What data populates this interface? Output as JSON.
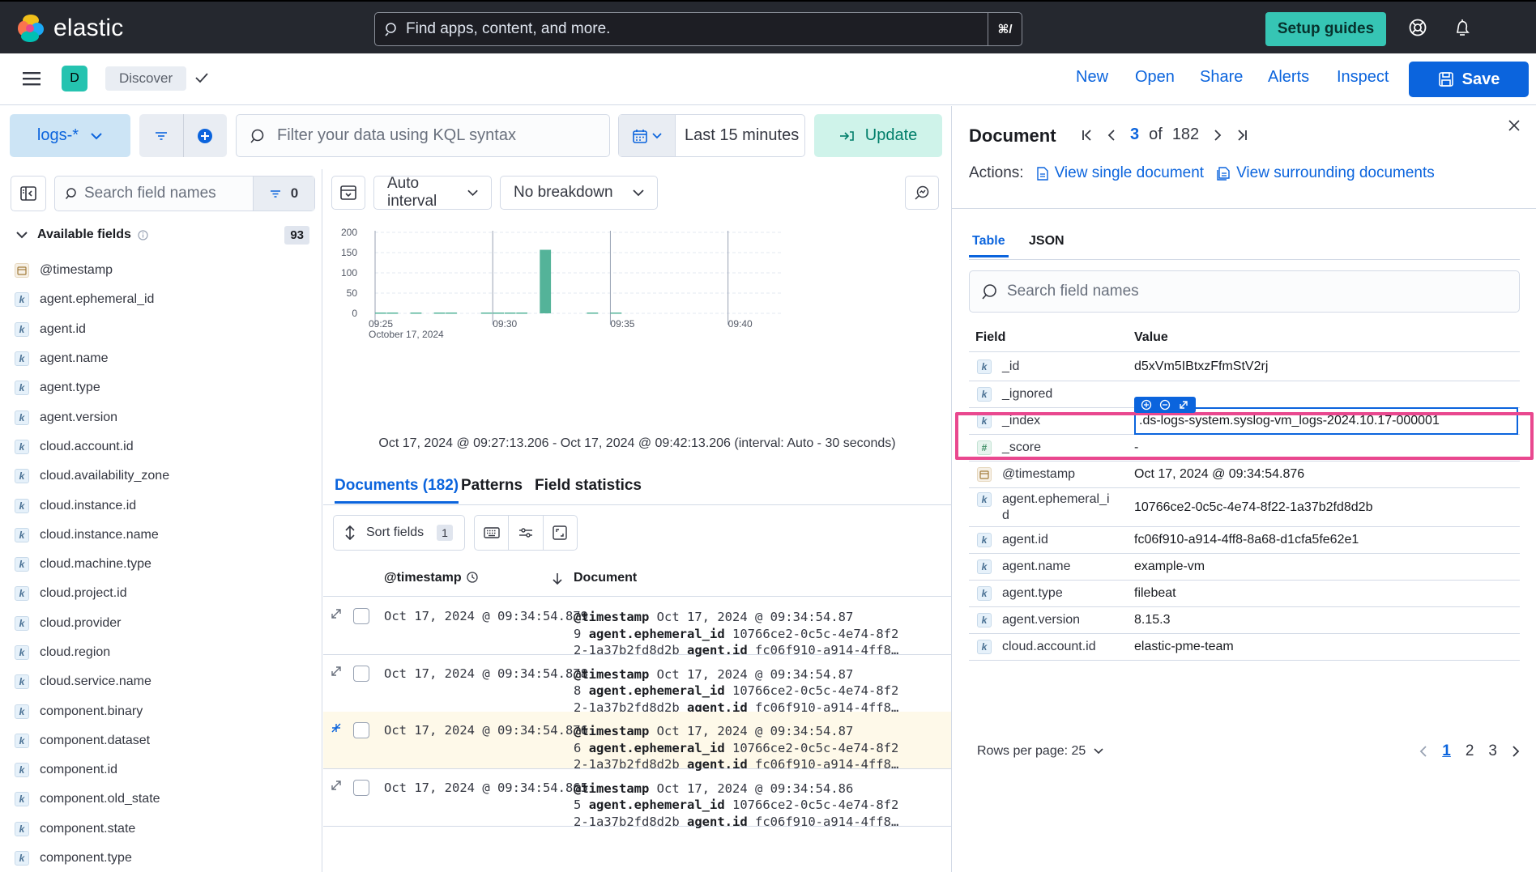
{
  "topbar": {
    "logo_text": "elastic",
    "search_placeholder": "Find apps, content, and more.",
    "search_shortcut": "⌘/",
    "setup_label": "Setup guides"
  },
  "appbar": {
    "space_letter": "D",
    "breadcrumb": "Discover",
    "nav": [
      "New",
      "Open",
      "Share",
      "Alerts",
      "Inspect"
    ],
    "save_label": "Save"
  },
  "querybar": {
    "dataview": "logs-*",
    "kql_placeholder": "Filter your data using KQL syntax",
    "time_label": "Last 15 minutes",
    "update_label": "Update"
  },
  "sidebar": {
    "search_placeholder": "Search field names",
    "filter_count": "0",
    "available_title": "Available fields",
    "available_count": "93",
    "fields": [
      {
        "name": "@timestamp",
        "type": "date"
      },
      {
        "name": "agent.ephemeral_id",
        "type": "keyword"
      },
      {
        "name": "agent.id",
        "type": "keyword"
      },
      {
        "name": "agent.name",
        "type": "keyword"
      },
      {
        "name": "agent.type",
        "type": "keyword"
      },
      {
        "name": "agent.version",
        "type": "keyword"
      },
      {
        "name": "cloud.account.id",
        "type": "keyword"
      },
      {
        "name": "cloud.availability_zone",
        "type": "keyword"
      },
      {
        "name": "cloud.instance.id",
        "type": "keyword"
      },
      {
        "name": "cloud.instance.name",
        "type": "keyword"
      },
      {
        "name": "cloud.machine.type",
        "type": "keyword"
      },
      {
        "name": "cloud.project.id",
        "type": "keyword"
      },
      {
        "name": "cloud.provider",
        "type": "keyword"
      },
      {
        "name": "cloud.region",
        "type": "keyword"
      },
      {
        "name": "cloud.service.name",
        "type": "keyword"
      },
      {
        "name": "component.binary",
        "type": "keyword"
      },
      {
        "name": "component.dataset",
        "type": "keyword"
      },
      {
        "name": "component.id",
        "type": "keyword"
      },
      {
        "name": "component.old_state",
        "type": "keyword"
      },
      {
        "name": "component.state",
        "type": "keyword"
      },
      {
        "name": "component.type",
        "type": "keyword"
      }
    ],
    "token_letters": {
      "keyword": "k",
      "number": "#",
      "date": ""
    }
  },
  "main": {
    "interval_label": "Auto interval",
    "breakdown_label": "No breakdown",
    "time_range_text": "Oct 17, 2024 @ 09:27:13.206 - Oct 17, 2024 @ 09:42:13.206 (interval: Auto - 30 seconds)",
    "tabs": [
      "Documents (182)",
      "Patterns",
      "Field statistics"
    ],
    "sort_label": "Sort fields",
    "sort_count": "1",
    "col_timestamp": "@timestamp",
    "col_document": "Document",
    "rows": [
      {
        "ts": "Oct 17, 2024 @ 09:34:54.879",
        "l1v": "Oct 17, 2024 @ 09:34:54.87",
        "l2a": "9",
        "l2b": "10766ce2-0c5c-4e74-8f2",
        "l3a": "2-1a37b2fd8d2b",
        "l3b": "fc06f910-a914-4ff8…",
        "highlight": false
      },
      {
        "ts": "Oct 17, 2024 @ 09:34:54.878",
        "l1v": "Oct 17, 2024 @ 09:34:54.87",
        "l2a": "8",
        "l2b": "10766ce2-0c5c-4e74-8f2",
        "l3a": "2-1a37b2fd8d2b",
        "l3b": "fc06f910-a914-4ff8…",
        "highlight": false
      },
      {
        "ts": "Oct 17, 2024 @ 09:34:54.876",
        "l1v": "Oct 17, 2024 @ 09:34:54.87",
        "l2a": "6",
        "l2b": "10766ce2-0c5c-4e74-8f2",
        "l3a": "2-1a37b2fd8d2b",
        "l3b": "fc06f910-a914-4ff8…",
        "highlight": true
      },
      {
        "ts": "Oct 17, 2024 @ 09:34:54.865",
        "l1v": "Oct 17, 2024 @ 09:34:54.86",
        "l2a": "5",
        "l2b": "10766ce2-0c5c-4e74-8f2",
        "l3a": "2-1a37b2fd8d2b",
        "l3b": "fc06f910-a914-4ff8…",
        "highlight": false
      }
    ],
    "doc_keys": {
      "timestamp": "@timestamp",
      "ephemeral": "agent.ephemeral_id",
      "agent_id": "agent.id"
    }
  },
  "chart_data": {
    "type": "bar",
    "yticks": [
      0,
      50,
      100,
      150,
      200
    ],
    "ylim": [
      0,
      200
    ],
    "xtick_labels": [
      "09:25\nOctober 17, 2024",
      "09:30",
      "09:35",
      "09:40"
    ],
    "xtick_minutes": [
      25,
      30,
      35,
      40
    ],
    "x_start_minute": 25,
    "x_end_minute": 42.25,
    "bucket_minutes": 0.5,
    "bars": [
      {
        "minute": 25.0,
        "value": 2
      },
      {
        "minute": 25.5,
        "value": 2
      },
      {
        "minute": 26.5,
        "value": 2
      },
      {
        "minute": 27.5,
        "value": 2
      },
      {
        "minute": 28.0,
        "value": 2
      },
      {
        "minute": 29.5,
        "value": 2
      },
      {
        "minute": 30.0,
        "value": 2
      },
      {
        "minute": 30.5,
        "value": 2
      },
      {
        "minute": 31.0,
        "value": 2
      },
      {
        "minute": 32.0,
        "value": 157
      },
      {
        "minute": 34.0,
        "value": 2
      },
      {
        "minute": 35.0,
        "value": 2
      }
    ],
    "bar_color": "#54b399",
    "grid": true
  },
  "flyout": {
    "title": "Document",
    "current": "3",
    "of_label": "of",
    "total": "182",
    "actions_label": "Actions:",
    "view_single": "View single document",
    "view_surrounding": "View surrounding documents",
    "tabs": [
      "Table",
      "JSON"
    ],
    "search_placeholder": "Search field names",
    "col_field": "Field",
    "col_value": "Value",
    "rows": [
      {
        "field": "_id",
        "type": "keyword",
        "value": "d5xVm5IBtxzFfmStV2rj"
      },
      {
        "field": "_ignored",
        "type": "keyword",
        "value": ""
      },
      {
        "field": "_index",
        "type": "keyword",
        "value": ".ds-logs-system.syslog-vm_logs-2024.10.17-000001"
      },
      {
        "field": "_score",
        "type": "number",
        "value": "-"
      },
      {
        "field": "@timestamp",
        "type": "date",
        "value": "Oct 17, 2024 @ 09:34:54.876"
      },
      {
        "field": "agent.ephemeral_i\nd",
        "type": "keyword",
        "value": "10766ce2-0c5c-4e74-8f22-1a37b2fd8d2b"
      },
      {
        "field": "agent.id",
        "type": "keyword",
        "value": "fc06f910-a914-4ff8-8a68-d1cfa5fe62e1"
      },
      {
        "field": "agent.name",
        "type": "keyword",
        "value": "example-vm"
      },
      {
        "field": "agent.type",
        "type": "keyword",
        "value": "filebeat"
      },
      {
        "field": "agent.version",
        "type": "keyword",
        "value": "8.15.3"
      },
      {
        "field": "cloud.account.id",
        "type": "keyword",
        "value": "elastic-pme-team"
      }
    ],
    "rows_per_page": "Rows per page: 25",
    "pages": [
      "1",
      "2",
      "3"
    ],
    "current_page": "1"
  },
  "colors": {
    "accent": "#0b64dd",
    "highlight_border": "#e9488f",
    "setup_bg": "#36c5b4",
    "chart_bar": "#54b399"
  }
}
